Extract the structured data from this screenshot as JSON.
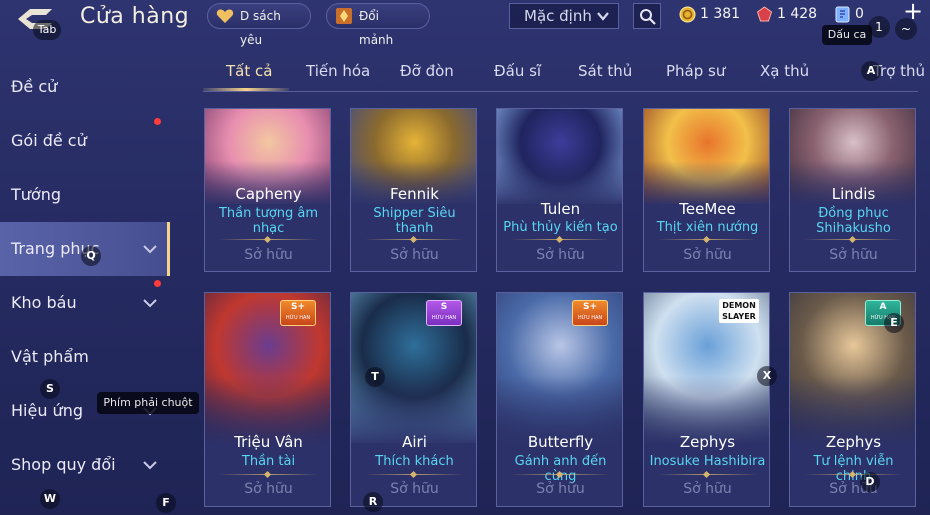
{
  "header": {
    "title": "Cửa hàng",
    "wishlist_label": "D sách yêu",
    "exchange_label": "Đổi mảnh",
    "sort_value": "Mặc định",
    "currencies": {
      "gold": "1 381",
      "gem": "1 428",
      "voucher": "0"
    },
    "plus": "+"
  },
  "sidebar": {
    "items": [
      {
        "label": "Đề cử",
        "dot": false,
        "chevron": false,
        "active": false
      },
      {
        "label": "Gói đề cử",
        "dot": true,
        "chevron": false,
        "active": false
      },
      {
        "label": "Tướng",
        "dot": false,
        "chevron": false,
        "active": false
      },
      {
        "label": "Trang phục",
        "dot": false,
        "chevron": true,
        "active": true
      },
      {
        "label": "Kho báu",
        "dot": true,
        "chevron": true,
        "active": false
      },
      {
        "label": "Vật phẩm",
        "dot": false,
        "chevron": false,
        "active": false
      },
      {
        "label": "Hiệu ứng",
        "dot": false,
        "chevron": true,
        "active": false
      },
      {
        "label": "Shop quy đổi",
        "dot": false,
        "chevron": true,
        "active": false
      }
    ]
  },
  "tabs": [
    {
      "label": "Tất cả",
      "active": true
    },
    {
      "label": "Tiến hóa",
      "active": false
    },
    {
      "label": "Đỡ đòn",
      "active": false
    },
    {
      "label": "Đấu sĩ",
      "active": false
    },
    {
      "label": "Sát thủ",
      "active": false
    },
    {
      "label": "Pháp sư",
      "active": false
    },
    {
      "label": "Xạ thủ",
      "active": false
    },
    {
      "label": "Trợ thủ",
      "active": false
    }
  ],
  "cards": [
    {
      "hero": "Capheny",
      "skin": "Thần tượng âm nhạc",
      "status": "Sở hữu",
      "art_colors": [
        "#f3c7a0",
        "#e88fb0",
        "#7a3a6a"
      ],
      "badge": null
    },
    {
      "hero": "Fennik",
      "skin": "Shipper Siêu thanh",
      "status": "Sở hữu",
      "art_colors": [
        "#e6b437",
        "#8b6a2e",
        "#3d4a8a"
      ],
      "badge": null
    },
    {
      "hero": "Tulen",
      "skin": "Phù thủy kiến tạo",
      "status": "Sở hữu",
      "art_colors": [
        "#3d3d9a",
        "#20245e",
        "#8fb6f2"
      ],
      "badge": null
    },
    {
      "hero": "TeeMee",
      "skin": "Thịt xiên nướng",
      "status": "Sở hữu",
      "art_colors": [
        "#e8742c",
        "#f2c04a",
        "#8a3a20"
      ],
      "badge": null
    },
    {
      "hero": "Lindis",
      "skin": "Đồng phục Shihakusho",
      "status": "Sở hữu",
      "art_colors": [
        "#d8c0c8",
        "#8a6270",
        "#3a2a3a"
      ],
      "badge": null
    },
    {
      "hero": "Triệu Vân",
      "skin": "Thần tài",
      "status": "Sở hữu",
      "art_colors": [
        "#6a3d8f",
        "#c0382f",
        "#2a1e4a"
      ],
      "badge": {
        "type": "splus",
        "label": "S+",
        "sub": "HỮU HẠN"
      }
    },
    {
      "hero": "Airi",
      "skin": "Thích khách",
      "status": "Sở hữu",
      "art_colors": [
        "#2f6f9a",
        "#1a2c4a",
        "#7ac0e8"
      ],
      "badge": {
        "type": "s",
        "label": "S",
        "sub": "HỮU HẠN"
      }
    },
    {
      "hero": "Butterfly",
      "skin": "Gánh anh đến cùng",
      "status": "Sở hữu",
      "art_colors": [
        "#b8c6e6",
        "#4a6aa8",
        "#2a3468"
      ],
      "badge": {
        "type": "splus",
        "label": "S+",
        "sub": "HỮU HẠN"
      }
    },
    {
      "hero": "Zephys",
      "skin": "Inosuke Hashibira",
      "status": "Sở hữu",
      "art_colors": [
        "#6aa0d8",
        "#cfe0f0",
        "#3a4a6a"
      ],
      "badge": {
        "type": "logo",
        "label": "DEMON SLAYER",
        "sub": ""
      }
    },
    {
      "hero": "Zephys",
      "skin": "Tư lệnh viễn chinh",
      "status": "Sở hữu",
      "art_colors": [
        "#e8c89a",
        "#6a5a4a",
        "#2a2a3a"
      ],
      "badge": {
        "type": "a",
        "label": "A",
        "sub": "HỮU HẠN"
      }
    }
  ],
  "key_hints": {
    "tab": "Tab",
    "num1": "1",
    "tilde": "~",
    "dauca": "Dấu ca",
    "a": "A",
    "q": "Q",
    "s": "S",
    "t": "T",
    "x": "X",
    "e": "E",
    "w": "W",
    "f": "F",
    "r": "R",
    "d": "D",
    "tooltip": "Phím phải chuột"
  },
  "colors": {
    "accent_gold": "#f4d48b",
    "skin_name": "#58d6f2",
    "owned": "#7d81ae",
    "notification_dot": "#ff3b3b"
  }
}
